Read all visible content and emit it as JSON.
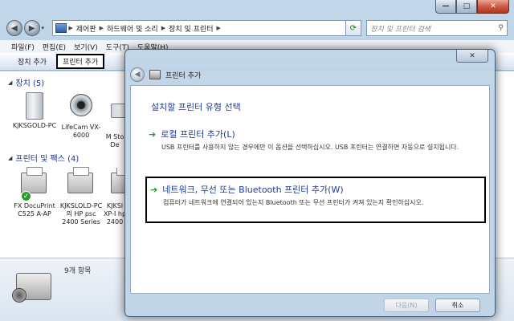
{
  "window": {
    "min": "—",
    "max": "□",
    "close": "✕"
  },
  "nav": {
    "back": "◀",
    "forward": "▶",
    "drop": "▾",
    "breadcrumb": [
      "제어판",
      "하드웨어 및 소리",
      "장치 및 프린터"
    ],
    "search_placeholder": "장치 및 프린터 검색"
  },
  "menu": [
    "파일(F)",
    "편집(E)",
    "보기(V)",
    "도구(T)",
    "도움말(H)"
  ],
  "toolbar": {
    "add_device": "장치 추가",
    "add_printer": "프린터 추가"
  },
  "devices_group": {
    "label": "장치 (5)"
  },
  "devices": [
    {
      "name": "KJKSGOLD-PC",
      "icon": "pc-icon"
    },
    {
      "name": "LifeCam VX-6000",
      "icon": "webcam-icon"
    },
    {
      "name": "M Sto De",
      "icon": "storage-icon"
    }
  ],
  "printers_group": {
    "label": "프린터 및 팩스 (4)"
  },
  "printers": [
    {
      "name": "FX DocuPrint C525 A-AP",
      "icon": "printer-icon",
      "default": true
    },
    {
      "name": "KJKSLOLD-PC의 HP psc 2400 Series",
      "icon": "printer-icon"
    },
    {
      "name": "KJKSI XP-I hp 2400",
      "icon": "printer-icon"
    }
  ],
  "status": {
    "count": "9개 항목"
  },
  "wizard": {
    "title": "프린터 추가",
    "close": "✕",
    "heading": "설치할 프린터 유형 선택",
    "option_local_title": "로컬 프린터 추가(L)",
    "option_local_desc": "USB 프린터를 사용하지 않는 경우에만 이 옵션을 선택하십시오. USB 프린터는 연결하면 자동으로 설치됩니다.",
    "option_network_title": "네트워크, 무선 또는 Bluetooth 프린터 추가(W)",
    "option_network_desc": "컴퓨터가 네트워크에 연결되어 있는지 Bluetooth 또는 무선 프린터가 켜져 있는지 확인하십시오.",
    "next_label": "다음(N)",
    "cancel_label": "취소",
    "arrow": "➔"
  }
}
